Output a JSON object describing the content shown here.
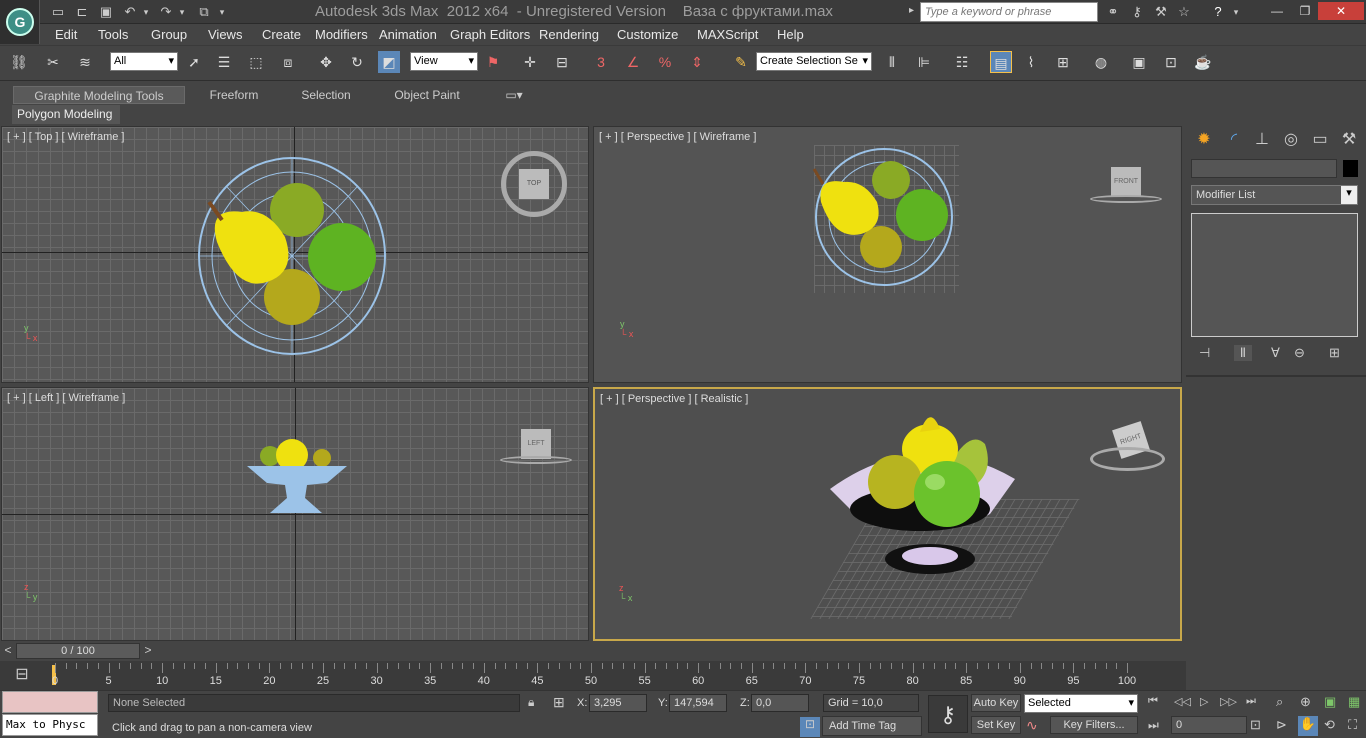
{
  "title": "Autodesk 3ds Max  2012 x64  - Unregistered Version    Ваза с фруктами.max",
  "search_placeholder": "Type a keyword or phrase",
  "menu": [
    "Edit",
    "Tools",
    "Group",
    "Views",
    "Create",
    "Modifiers",
    "Animation",
    "Graph Editors",
    "Rendering",
    "Customize",
    "MAXScript",
    "Help"
  ],
  "toolbar": {
    "filter_value": "All",
    "refcoord_value": "View",
    "selection_set_value": "Create Selection Se"
  },
  "ribbon": {
    "tabs": [
      "Graphite Modeling Tools",
      "Freeform",
      "Selection",
      "Object Paint"
    ],
    "panel_label": "Polygon Modeling"
  },
  "viewports": {
    "top": "[ + ] [ Top ] [ Wireframe ]",
    "persp_wire": "[ + ] [ Perspective ] [ Wireframe ]",
    "left": "[ + ] [ Left ] [ Wireframe ]",
    "persp_real": "[ + ] [ Perspective ] [ Realistic ]",
    "cube_top": "TOP",
    "cube_front": "FRONT",
    "cube_left": "LEFT",
    "cube_right": "RIGHT"
  },
  "cmd_panel": {
    "modifier_list": "Modifier List"
  },
  "time": {
    "slider_text": "0 / 100",
    "ticks": [
      "0",
      "5",
      "10",
      "15",
      "20",
      "25",
      "30",
      "35",
      "40",
      "45",
      "50",
      "55",
      "60",
      "65",
      "70",
      "75",
      "80",
      "85",
      "90",
      "95",
      "100"
    ]
  },
  "status": {
    "maxscript_line": "Max to Physc",
    "selection": "None Selected",
    "prompt": "Click and drag to pan a non-camera view",
    "x_label": "X:",
    "x_value": "3,295",
    "y_label": "Y:",
    "y_value": "147,594",
    "z_label": "Z:",
    "z_value": "0,0",
    "grid": "Grid = 10,0",
    "add_time_tag": "Add Time Tag",
    "auto_key": "Auto Key",
    "set_key": "Set Key",
    "selected_value": "Selected",
    "key_filters": "Key Filters...",
    "frame_value": "0"
  }
}
